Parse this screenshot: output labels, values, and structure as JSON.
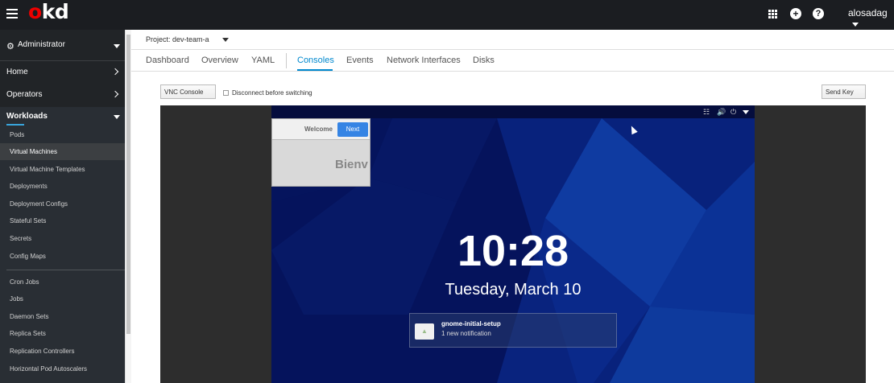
{
  "masthead": {
    "logo": "okd",
    "user": "alosadag"
  },
  "sidebar": {
    "perspective": "Administrator",
    "main_items": [
      "Home",
      "Operators"
    ],
    "workloads": {
      "label": "Workloads",
      "items": [
        "Pods",
        "Virtual Machines",
        "Virtual Machine Templates",
        "Deployments",
        "Deployment Configs",
        "Stateful Sets",
        "Secrets",
        "Config Maps"
      ],
      "items2": [
        "Cron Jobs",
        "Jobs",
        "Daemon Sets",
        "Replica Sets",
        "Replication Controllers",
        "Horizontal Pod Autoscalers"
      ],
      "active": "Virtual Machines"
    }
  },
  "project": {
    "label": "Project: dev-team-a"
  },
  "tabs": [
    "Dashboard",
    "Overview",
    "YAML",
    "Consoles",
    "Events",
    "Network Interfaces",
    "Disks"
  ],
  "active_tab": "Consoles",
  "console": {
    "type_button": "VNC Console",
    "disconnect_label": "Disconnect before switching",
    "send_key": "Send Key"
  },
  "vm_screen": {
    "welcome_title": "Welcome",
    "next_button": "Next",
    "bienvenue_fragment": "Bienv",
    "time": "10:28",
    "date": "Tuesday, March 10",
    "notification_title": "gnome-initial-setup",
    "notification_text": "1 new notification"
  },
  "colors": {
    "accent": "#0088ce",
    "logo_red": "#ee0000",
    "masthead": "#1b1d21",
    "sidebar": "#212427"
  }
}
